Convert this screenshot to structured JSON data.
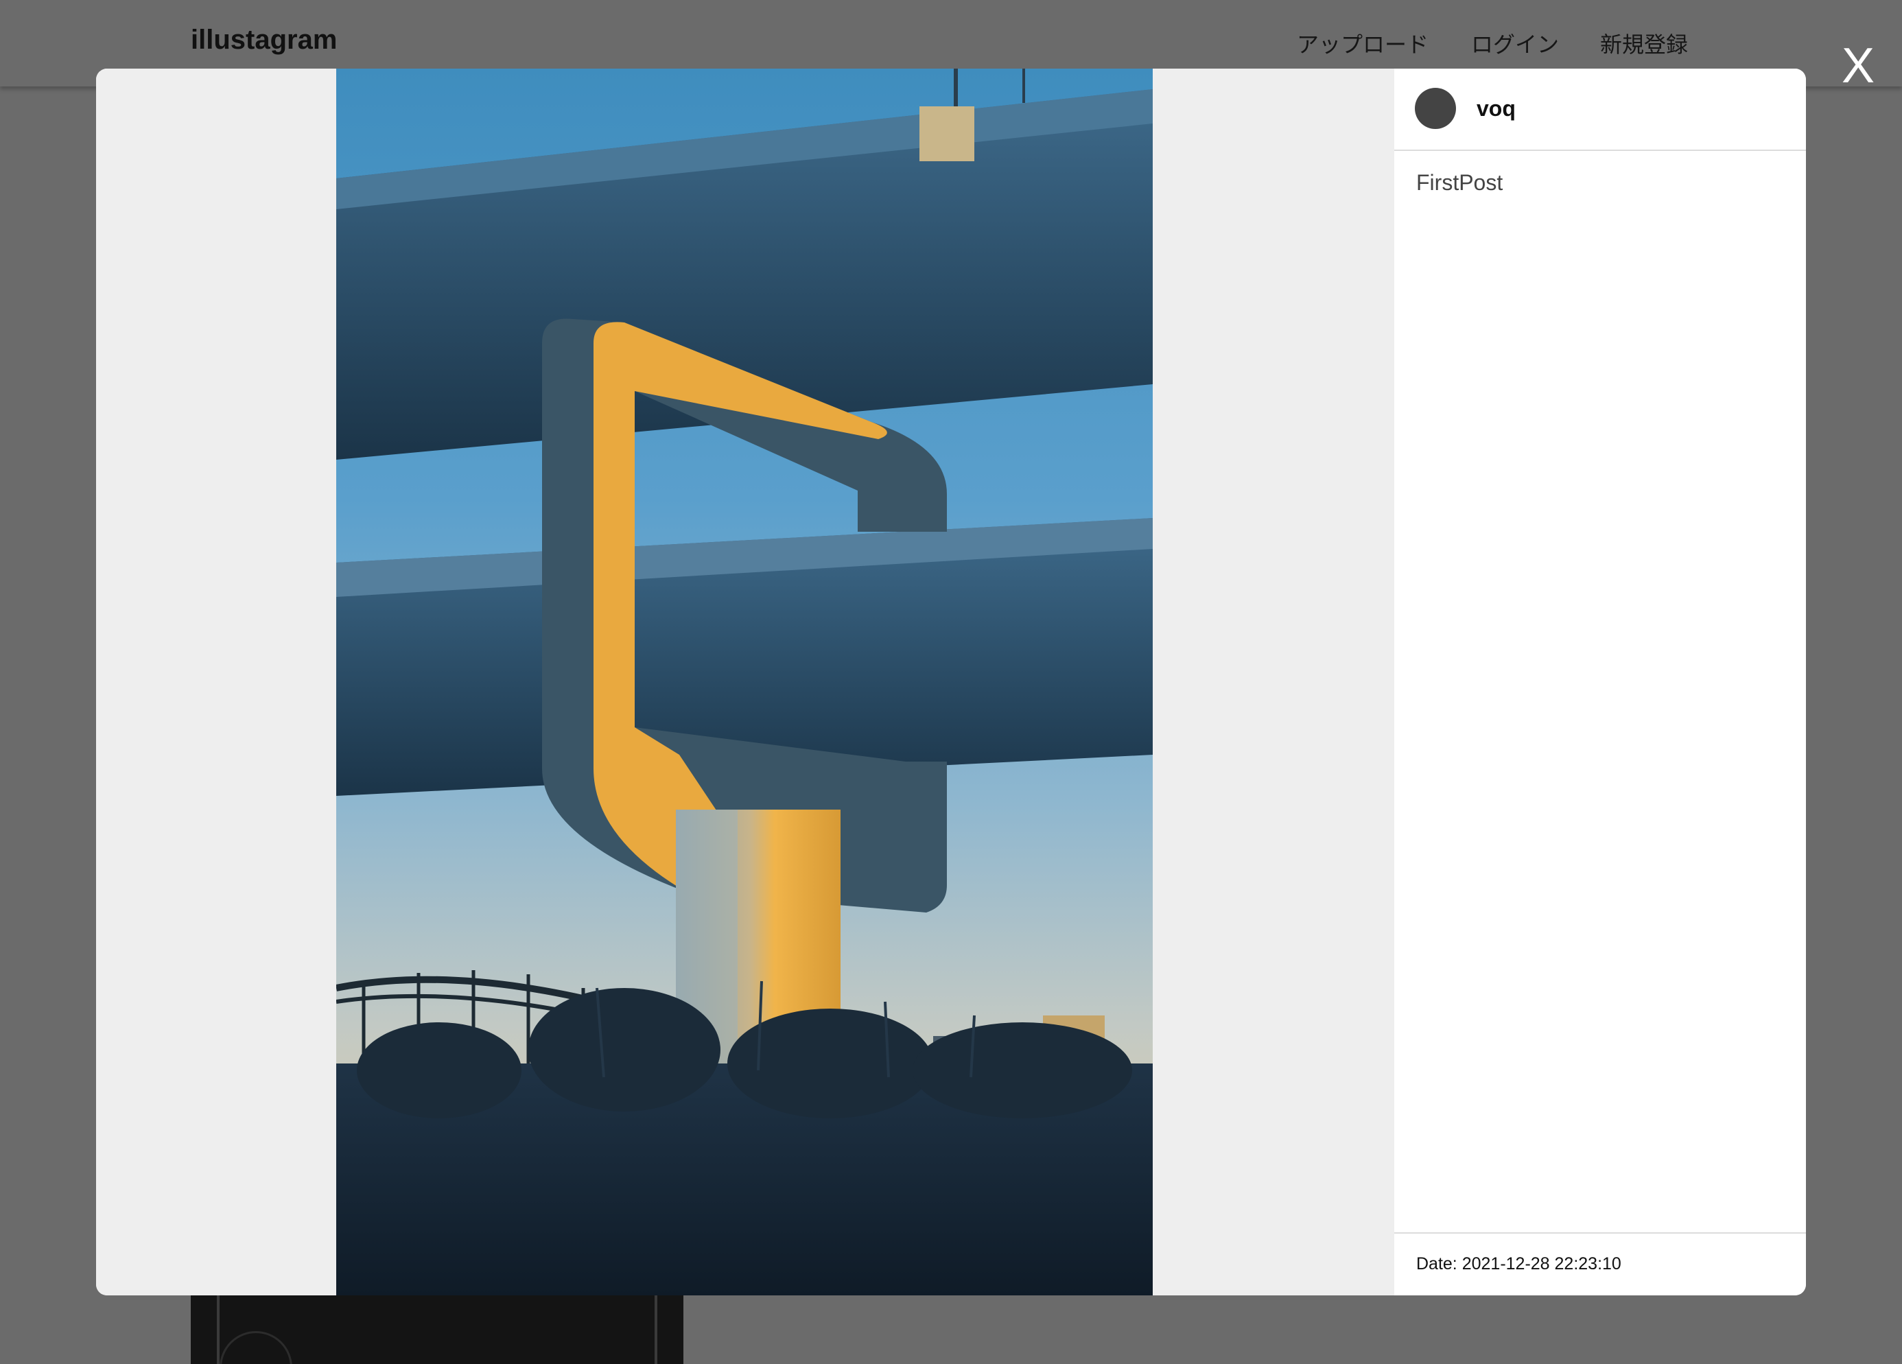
{
  "app": {
    "brand": "illustagram"
  },
  "nav": {
    "upload": "アップロード",
    "login": "ログイン",
    "signup": "新規登録"
  },
  "modal": {
    "close_label": "X",
    "post": {
      "username": "voq",
      "caption": "FirstPost",
      "date": "Date: 2021-12-28 22:23:10"
    }
  },
  "colors": {
    "overlay": "#6b6b6b",
    "image_pane_bg": "#eeeeee",
    "avatar": "#444444",
    "pillar_yellow": "#e9a93f"
  }
}
